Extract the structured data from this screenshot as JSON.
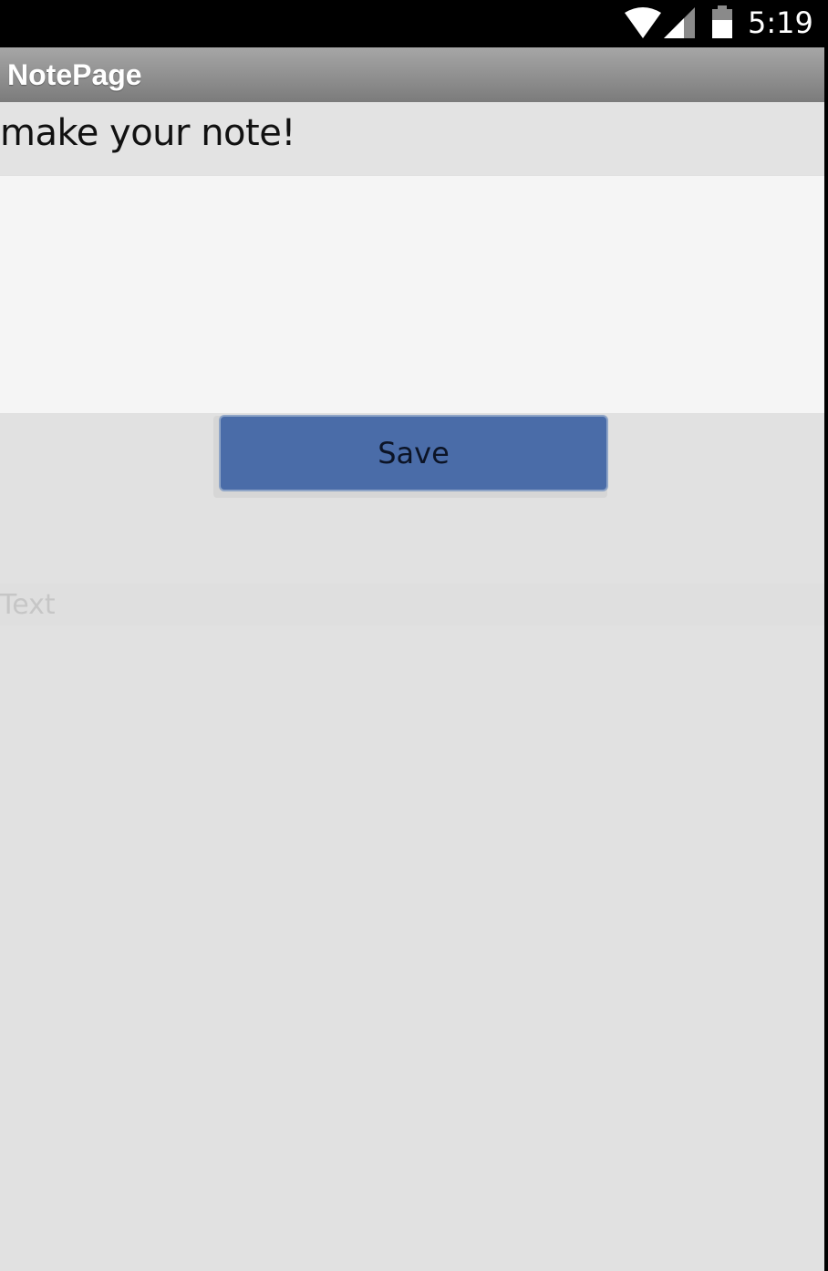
{
  "status_bar": {
    "time": "5:19",
    "icons": [
      "wifi-icon",
      "signal-icon",
      "battery-icon"
    ]
  },
  "app_bar": {
    "title": "NotePage"
  },
  "note": {
    "prompt": "make your note!",
    "input_value": "",
    "save_label": "Save"
  },
  "output": {
    "text": "Text"
  },
  "colors": {
    "status_bar": "#000000",
    "app_bar_top": "#a6a6a6",
    "app_bar_bottom": "#7b7b7b",
    "background": "#e1e1e1",
    "input_background": "#f5f5f5",
    "button": "#4a6ca8"
  }
}
